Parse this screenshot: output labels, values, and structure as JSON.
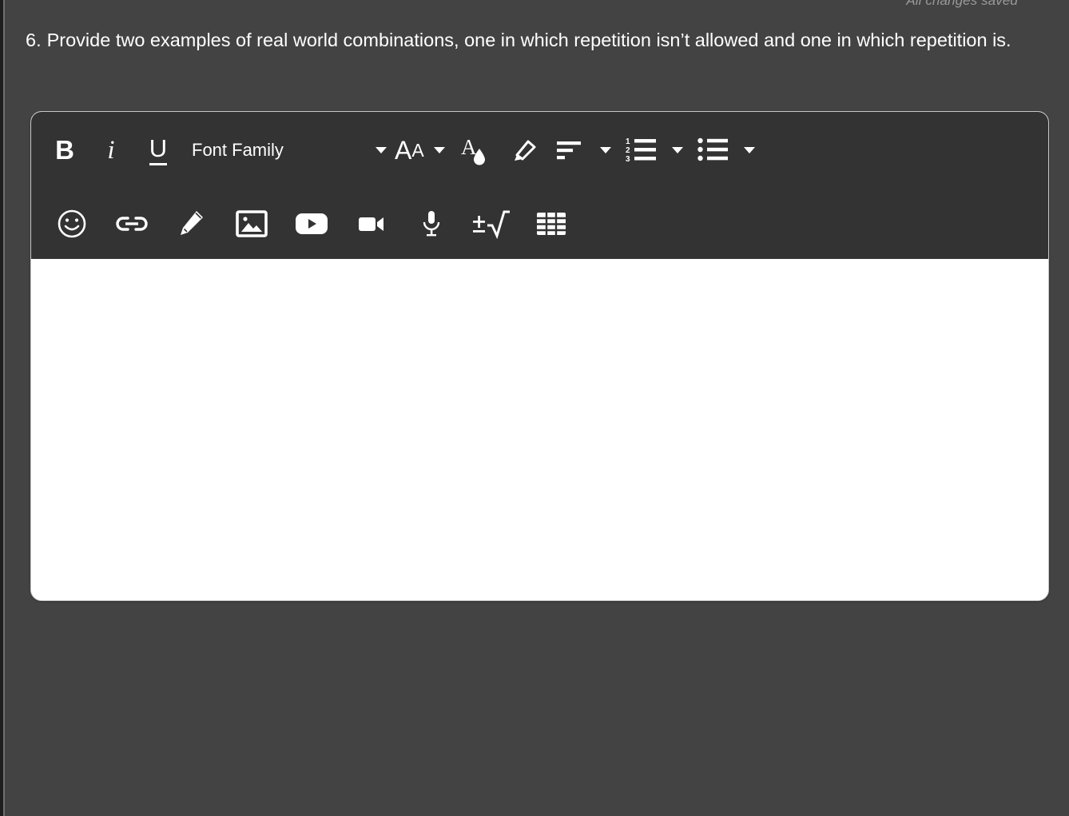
{
  "status": {
    "saved_label": "All changes saved"
  },
  "question": {
    "number": "6.",
    "text": "Provide two examples of real world combinations, one in which repetition isn’t allowed and one in which repetition is."
  },
  "editor": {
    "answer_value": "",
    "toolbar": {
      "row1": {
        "bold_label": "B",
        "italic_label": "i",
        "underline_label": "U",
        "font_family_label": "Font Family",
        "font_size_big": "A",
        "font_size_small": "A",
        "items": [
          {
            "name": "bold-button",
            "icon": "bold-icon",
            "label": "B"
          },
          {
            "name": "italic-button",
            "icon": "italic-icon",
            "label": "i"
          },
          {
            "name": "underline-button",
            "icon": "underline-icon",
            "label": "U"
          },
          {
            "name": "font-family-select",
            "icon": "chevron-down-icon",
            "label": "Font Family"
          },
          {
            "name": "font-size-button",
            "icon": "font-size-icon",
            "label": "AA"
          },
          {
            "name": "text-color-button",
            "icon": "text-color-droplet-icon",
            "label": ""
          },
          {
            "name": "highlight-button",
            "icon": "highlighter-icon",
            "label": ""
          },
          {
            "name": "align-button",
            "icon": "align-left-icon",
            "label": ""
          },
          {
            "name": "numbered-list-button",
            "icon": "numbered-list-icon",
            "label": ""
          },
          {
            "name": "bulleted-list-button",
            "icon": "bulleted-list-icon",
            "label": ""
          }
        ]
      },
      "row2": {
        "items": [
          {
            "name": "emoji-button",
            "icon": "smiley-face-icon"
          },
          {
            "name": "link-button",
            "icon": "link-chain-icon"
          },
          {
            "name": "draw-button",
            "icon": "pencil-icon"
          },
          {
            "name": "image-button",
            "icon": "image-icon"
          },
          {
            "name": "youtube-video-button",
            "icon": "youtube-play-icon"
          },
          {
            "name": "record-video-button",
            "icon": "video-camera-icon"
          },
          {
            "name": "record-audio-button",
            "icon": "microphone-icon"
          },
          {
            "name": "equation-button",
            "icon": "math-equation-icon"
          },
          {
            "name": "table-button",
            "icon": "table-grid-icon"
          }
        ]
      }
    }
  },
  "colors": {
    "page_background": "#434343",
    "toolbar_background": "#333333",
    "canvas_background": "#ffffff",
    "text_primary": "#ffffff",
    "status_text": "#9a9a9a",
    "editor_border": "#c8c8c8"
  }
}
